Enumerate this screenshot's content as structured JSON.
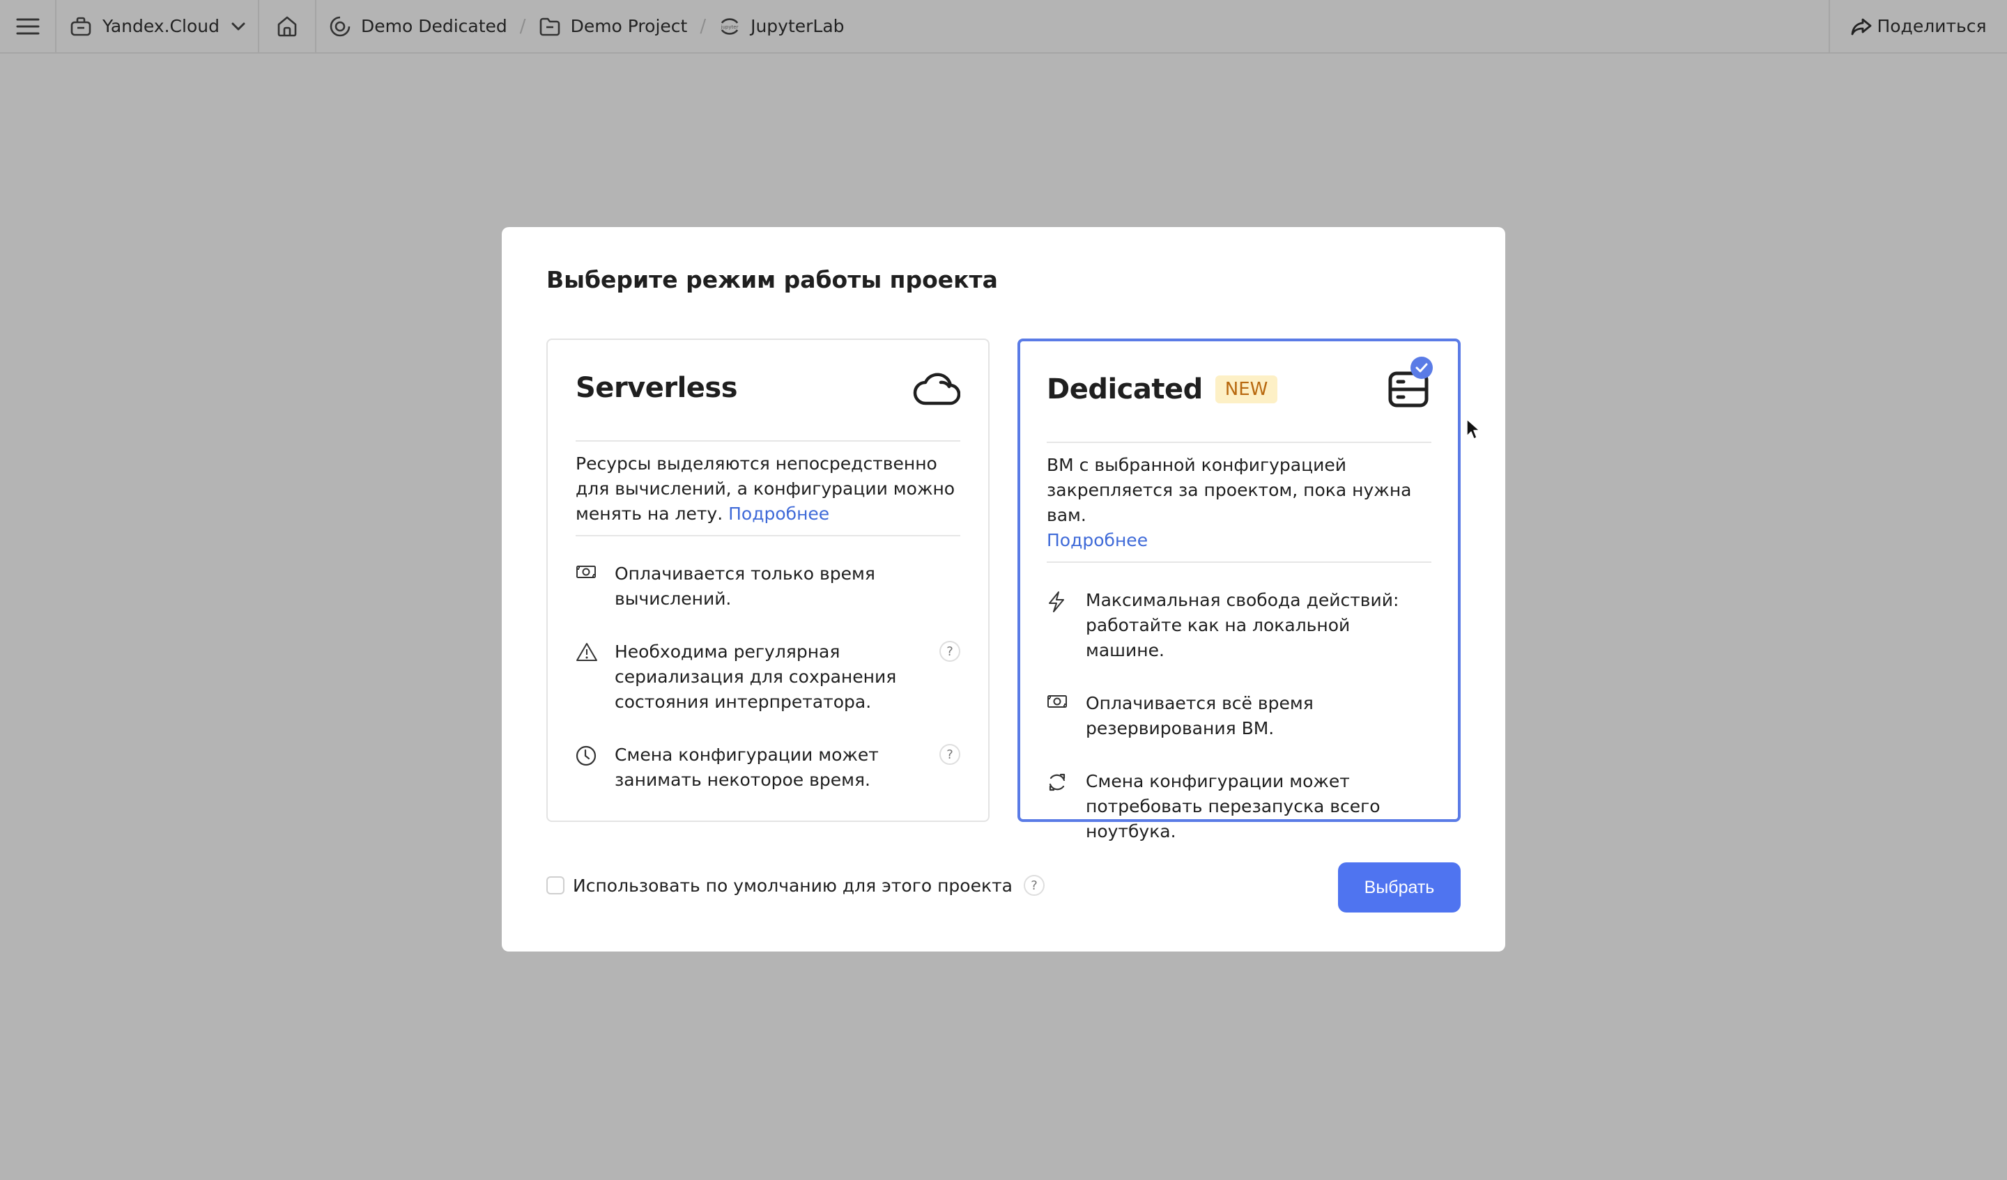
{
  "topbar": {
    "menu_icon": "hamburger-icon",
    "organization": {
      "icon": "briefcase-icon",
      "label": "Yandex.Cloud",
      "dropdown_icon": "chevron-down-icon"
    },
    "home_icon": "home-icon",
    "breadcrumbs": [
      {
        "icon": "community-icon",
        "label": "Demo Dedicated"
      },
      {
        "icon": "folder-icon",
        "label": "Demo Project"
      },
      {
        "icon": "jupyter-icon",
        "label": "JupyterLab"
      }
    ],
    "breadcrumb_separator": "/",
    "share": {
      "icon": "share-arrow-icon",
      "label": "Поделиться"
    }
  },
  "dialog": {
    "title": "Выберите режим работы проекта",
    "selected_mode": "Dedicated",
    "cards": [
      {
        "id": "serverless",
        "title": "Serverless",
        "icon": "cloud-icon",
        "selected": false,
        "description": "Ресурсы выделяются непосредственно для вычислений, а конфигурации можно менять на лету.",
        "more_link": "Подробнее",
        "features": [
          {
            "icon": "money-icon",
            "text": "Оплачивается только время вычислений.",
            "has_help": false
          },
          {
            "icon": "warning-triangle-icon",
            "text": "Необходима регулярная сериализация для сохранения состояния интерпретатора.",
            "has_help": true
          },
          {
            "icon": "clock-icon",
            "text": "Смена конфигурации может занимать некоторое время.",
            "has_help": true
          }
        ]
      },
      {
        "id": "dedicated",
        "title": "Dedicated",
        "badge": "NEW",
        "icon": "server-icon",
        "selected": true,
        "description": "ВМ с выбранной конфигурацией закрепляется за проектом, пока нужна вам.",
        "more_link": "Подробнее",
        "features": [
          {
            "icon": "lightning-icon",
            "text": "Максимальная свобода действий: работайте как на локальной машине.",
            "has_help": false
          },
          {
            "icon": "money-icon",
            "text": "Оплачивается всё время резервирования ВМ.",
            "has_help": false
          },
          {
            "icon": "refresh-icon",
            "text": "Смена конфигурации может потребовать перезапуска всего ноутбука.",
            "has_help": false
          }
        ]
      }
    ],
    "help_glyph": "?",
    "default_checkbox": {
      "label": "Использовать по умолчанию для этого проекта",
      "checked": false
    },
    "submit_label": "Выбрать"
  },
  "colors": {
    "overlay": "#b4b4b4",
    "accent": "#4f74f0",
    "selected_border": "#5a7be6",
    "link": "#3f6ad8",
    "badge_bg": "#fdf0c6",
    "badge_text": "#b8690f"
  }
}
